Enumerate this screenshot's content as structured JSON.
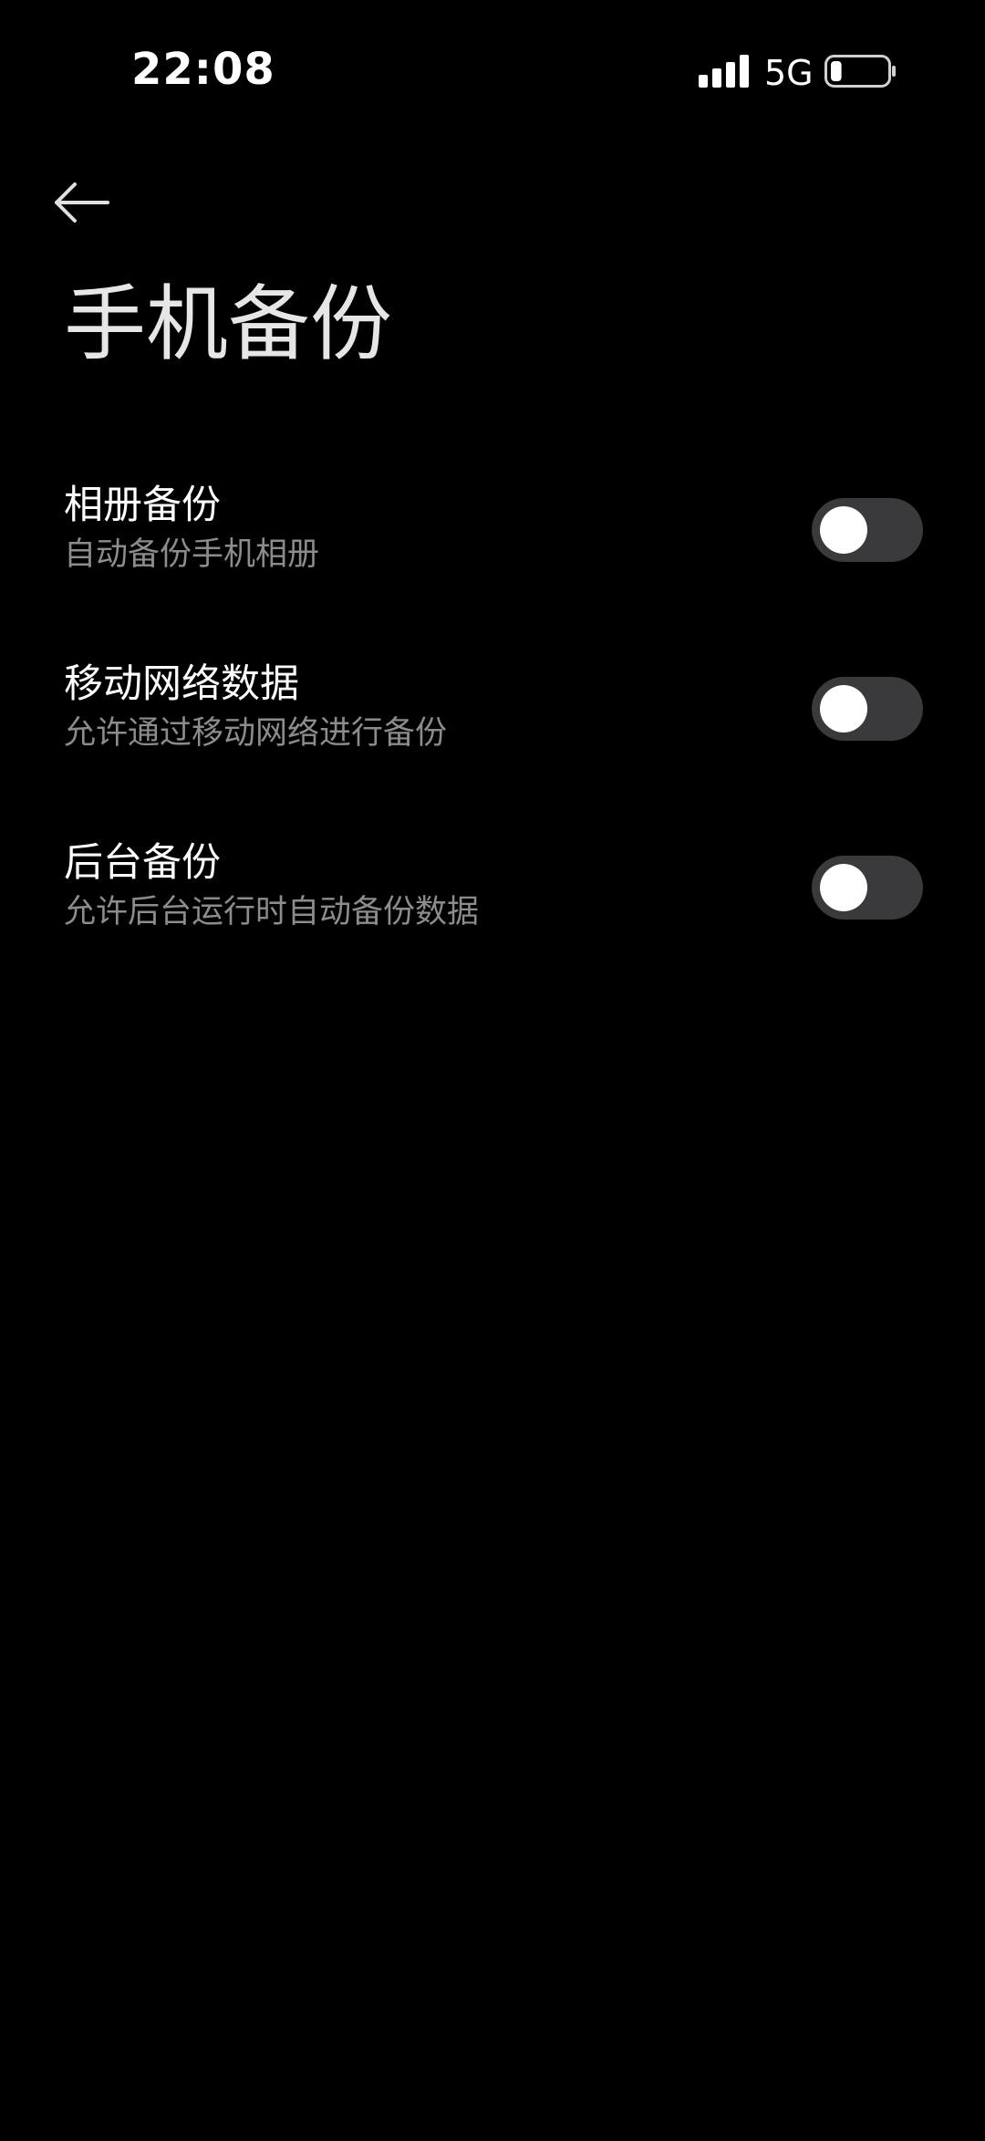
{
  "status_bar": {
    "time": "22:08",
    "network": "5G",
    "signal_icon": "signal-bars-icon",
    "battery_icon": "battery-low-icon",
    "battery_level_percent": 20
  },
  "header": {
    "back_icon": "arrow-left-icon",
    "title": "手机备份"
  },
  "settings": [
    {
      "label": "相册备份",
      "description": "自动备份手机相册",
      "enabled": false
    },
    {
      "label": "移动网络数据",
      "description": "允许通过移动网络进行备份",
      "enabled": false
    },
    {
      "label": "后台备份",
      "description": "允许后台运行时自动备份数据",
      "enabled": false
    }
  ],
  "colors": {
    "background": "#000000",
    "toggle_track_off": "#3a3a3c",
    "toggle_knob": "#ffffff",
    "secondary_text": "#8c8c8c"
  }
}
